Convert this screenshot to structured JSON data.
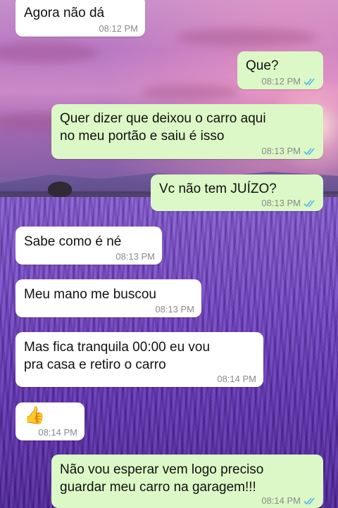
{
  "colors": {
    "incoming_bubble": "#ffffff",
    "outgoing_bubble": "#dcf8c6",
    "read_ticks": "#4fb6ec",
    "timestamp": "#8a8a8a"
  },
  "messages": [
    {
      "direction": "in",
      "text": "Agora não dá",
      "time": "08:12 PM"
    },
    {
      "direction": "out",
      "text": "Que?",
      "time": "08:12 PM",
      "status": "read-ticks-icon"
    },
    {
      "direction": "out",
      "text": "Quer dizer que deixou o carro aqui\nno meu portão e saiu é isso",
      "time": "08:13 PM",
      "status": "read-ticks-icon"
    },
    {
      "direction": "out",
      "text": "Vc não tem JUÍZO?",
      "time": "08:13 PM",
      "status": "read-ticks-icon"
    },
    {
      "direction": "in",
      "text": "Sabe como é né",
      "time": "08:13 PM"
    },
    {
      "direction": "in",
      "text": "Meu mano me buscou",
      "time": "08:13 PM"
    },
    {
      "direction": "in",
      "text": "Mas fica tranquila 00:00 eu vou\npra casa e retiro o carro",
      "time": "08:14 PM"
    },
    {
      "direction": "in",
      "text": "👍",
      "time": "08:14 PM"
    },
    {
      "direction": "out",
      "text": "Não vou esperar vem logo preciso\nguardar meu carro na garagem!!!",
      "time": "08:14 PM",
      "status": "read-ticks-icon"
    }
  ]
}
